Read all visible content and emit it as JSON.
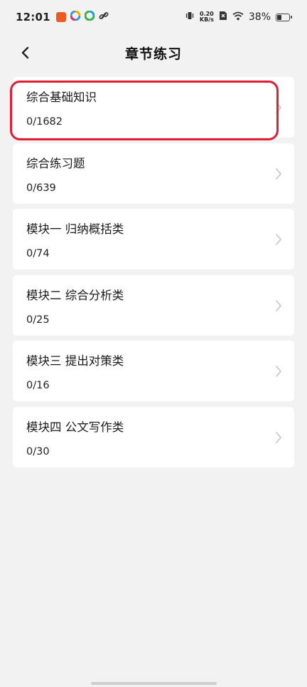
{
  "status_bar": {
    "time": "12:01",
    "net_speed_value": "0.20",
    "net_speed_unit": "KB/s",
    "battery": "38%",
    "battery_level": 0.38
  },
  "header": {
    "title": "章节练习"
  },
  "chapters": [
    {
      "title": "综合基础知识",
      "count": "0/1682"
    },
    {
      "title": "综合练习题",
      "count": "0/639"
    },
    {
      "title": "模块一 归纳概括类",
      "count": "0/74"
    },
    {
      "title": "模块二 综合分析类",
      "count": "0/25"
    },
    {
      "title": "模块三 提出对策类",
      "count": "0/16"
    },
    {
      "title": "模块四 公文写作类",
      "count": "0/30"
    }
  ],
  "colors": {
    "background": "#f2f2f2",
    "card": "#ffffff",
    "highlight": "#e01e35",
    "chevron": "#c4c4c4"
  },
  "icons": {
    "back": "chevron-left-icon",
    "item_arrow": "chevron-right-icon"
  }
}
